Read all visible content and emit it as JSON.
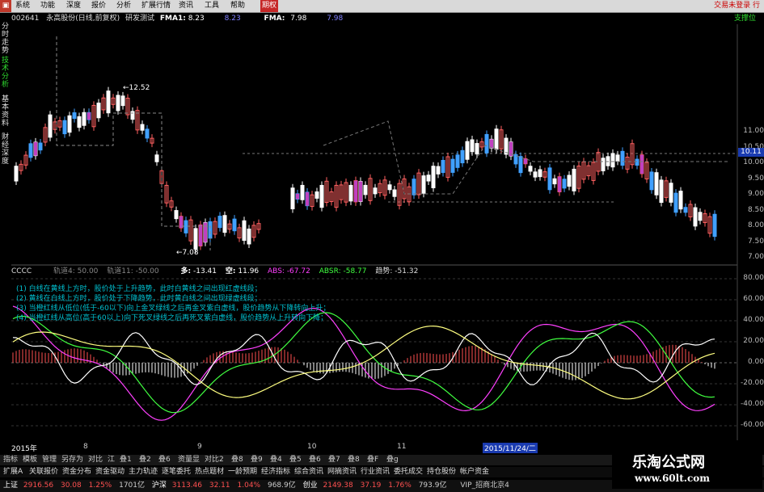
{
  "menu": {
    "items": [
      "系统",
      "功能",
      "深度",
      "报价",
      "分析",
      "扩展行情",
      "资讯",
      "工具",
      "帮助",
      "期权"
    ],
    "active": "期权",
    "right": "交易未登录  行"
  },
  "sidetabs": [
    "分时走势",
    "技术分析",
    "基本资料",
    "财经深度"
  ],
  "info": {
    "code": "002641",
    "name": "永高股份(日线,前复权)",
    "indicator": "研发测试",
    "ma1_label": "FMA1:",
    "ma1_val": "8.23",
    "ma1_val2": "8.23",
    "ma2_label": "FMA:",
    "ma2_val": "7.98",
    "ma2_val2": "7.98",
    "extra": "支撑位"
  },
  "price_axis": {
    "ticks": [
      "11.00",
      "10.50",
      "10.00",
      "9.50",
      "9.00",
      "8.50",
      "8.00",
      "7.50",
      "7.00"
    ],
    "current": "10.11"
  },
  "annotations": {
    "high": "12.52",
    "low": "7.08"
  },
  "indicator": {
    "name": "CCCC",
    "p1": "轨道4: 50.00",
    "p2": "轨道11: -50.00",
    "duo_l": "多:",
    "duo": "-13.41",
    "kong_l": "空:",
    "kong": "11.96",
    "abs_l": "ABS:",
    "abs": "-67.72",
    "absr_l": "ABSR:",
    "absr": "-58.77",
    "trend_l": "趋势:",
    "trend": "-51.32"
  },
  "notes": [
    "(1) 白线在黄线上方时，股价处于上升趋势，此时白黄线之间出现红虚线段；",
    "(2) 黄线在白线上方时，股价处于下降趋势，此时黄白线之间出现绿虚线段；",
    "(3) 当橙红线从低位(低于-60以下)向上金叉绿线之后再金叉紫白虚线，股价趋势从下降转向上升；",
    "(4) 当橙红线从高位(高于60以上)向下死叉绿线之后再死叉紫白虚线，股价趋势从上升转向下降；"
  ],
  "ind_axis": {
    "ticks": [
      "80.00",
      "60.00",
      "40.00",
      "20.00",
      "0.00",
      "-20.00",
      "-40.00",
      "-60.00"
    ]
  },
  "dates": {
    "year": "2015年",
    "m8": "8",
    "m9": "9",
    "m10": "10",
    "m11": "11",
    "cursor": "2015/11/24/二"
  },
  "tools1": [
    "指标",
    "模板",
    "管理",
    "另存为",
    "对比",
    "江",
    "叠1",
    "叠2",
    "叠6",
    "资量显",
    "对比2",
    "叠8",
    "叠9",
    "叠4",
    "叠5",
    "叠6",
    "叠7",
    "叠8",
    "叠F",
    "叠g"
  ],
  "tools2": [
    "扩展A",
    "关联报价",
    "资金分布",
    "资金驱动",
    "主力轨迹",
    "逐笔委托",
    "热点题材",
    "一龄预期",
    "经济指标",
    "综合资讯",
    "网摘资讯",
    "行业资讯",
    "委托成交",
    "持仓股份",
    "帐户资金"
  ],
  "status": {
    "sh_l": "上证",
    "sh": "2916.56",
    "sh_c": "30.08",
    "sh_p": "1.25%",
    "sh_v": "1701亿",
    "sz_l": "沪深",
    "sz": "3113.46",
    "sz_c": "32.11",
    "sz_p": "1.04%",
    "sz_v": "968.9亿",
    "cy_l": "创业",
    "cy": "2149.38",
    "cy_c": "37.19",
    "cy_p": "1.76%",
    "cy_v": "793.9亿",
    "vip": "VIP_招商北京4"
  },
  "watermark": {
    "title": "乐淘公式网",
    "url": "www.60lt.com"
  },
  "colors": {
    "up": "#ff5050",
    "down": "#3aa0ff",
    "white": "#ffffff",
    "yellow": "#ffd700",
    "magenta": "#ff40ff",
    "green": "#40ff40",
    "cyan": "#00c0d0"
  }
}
